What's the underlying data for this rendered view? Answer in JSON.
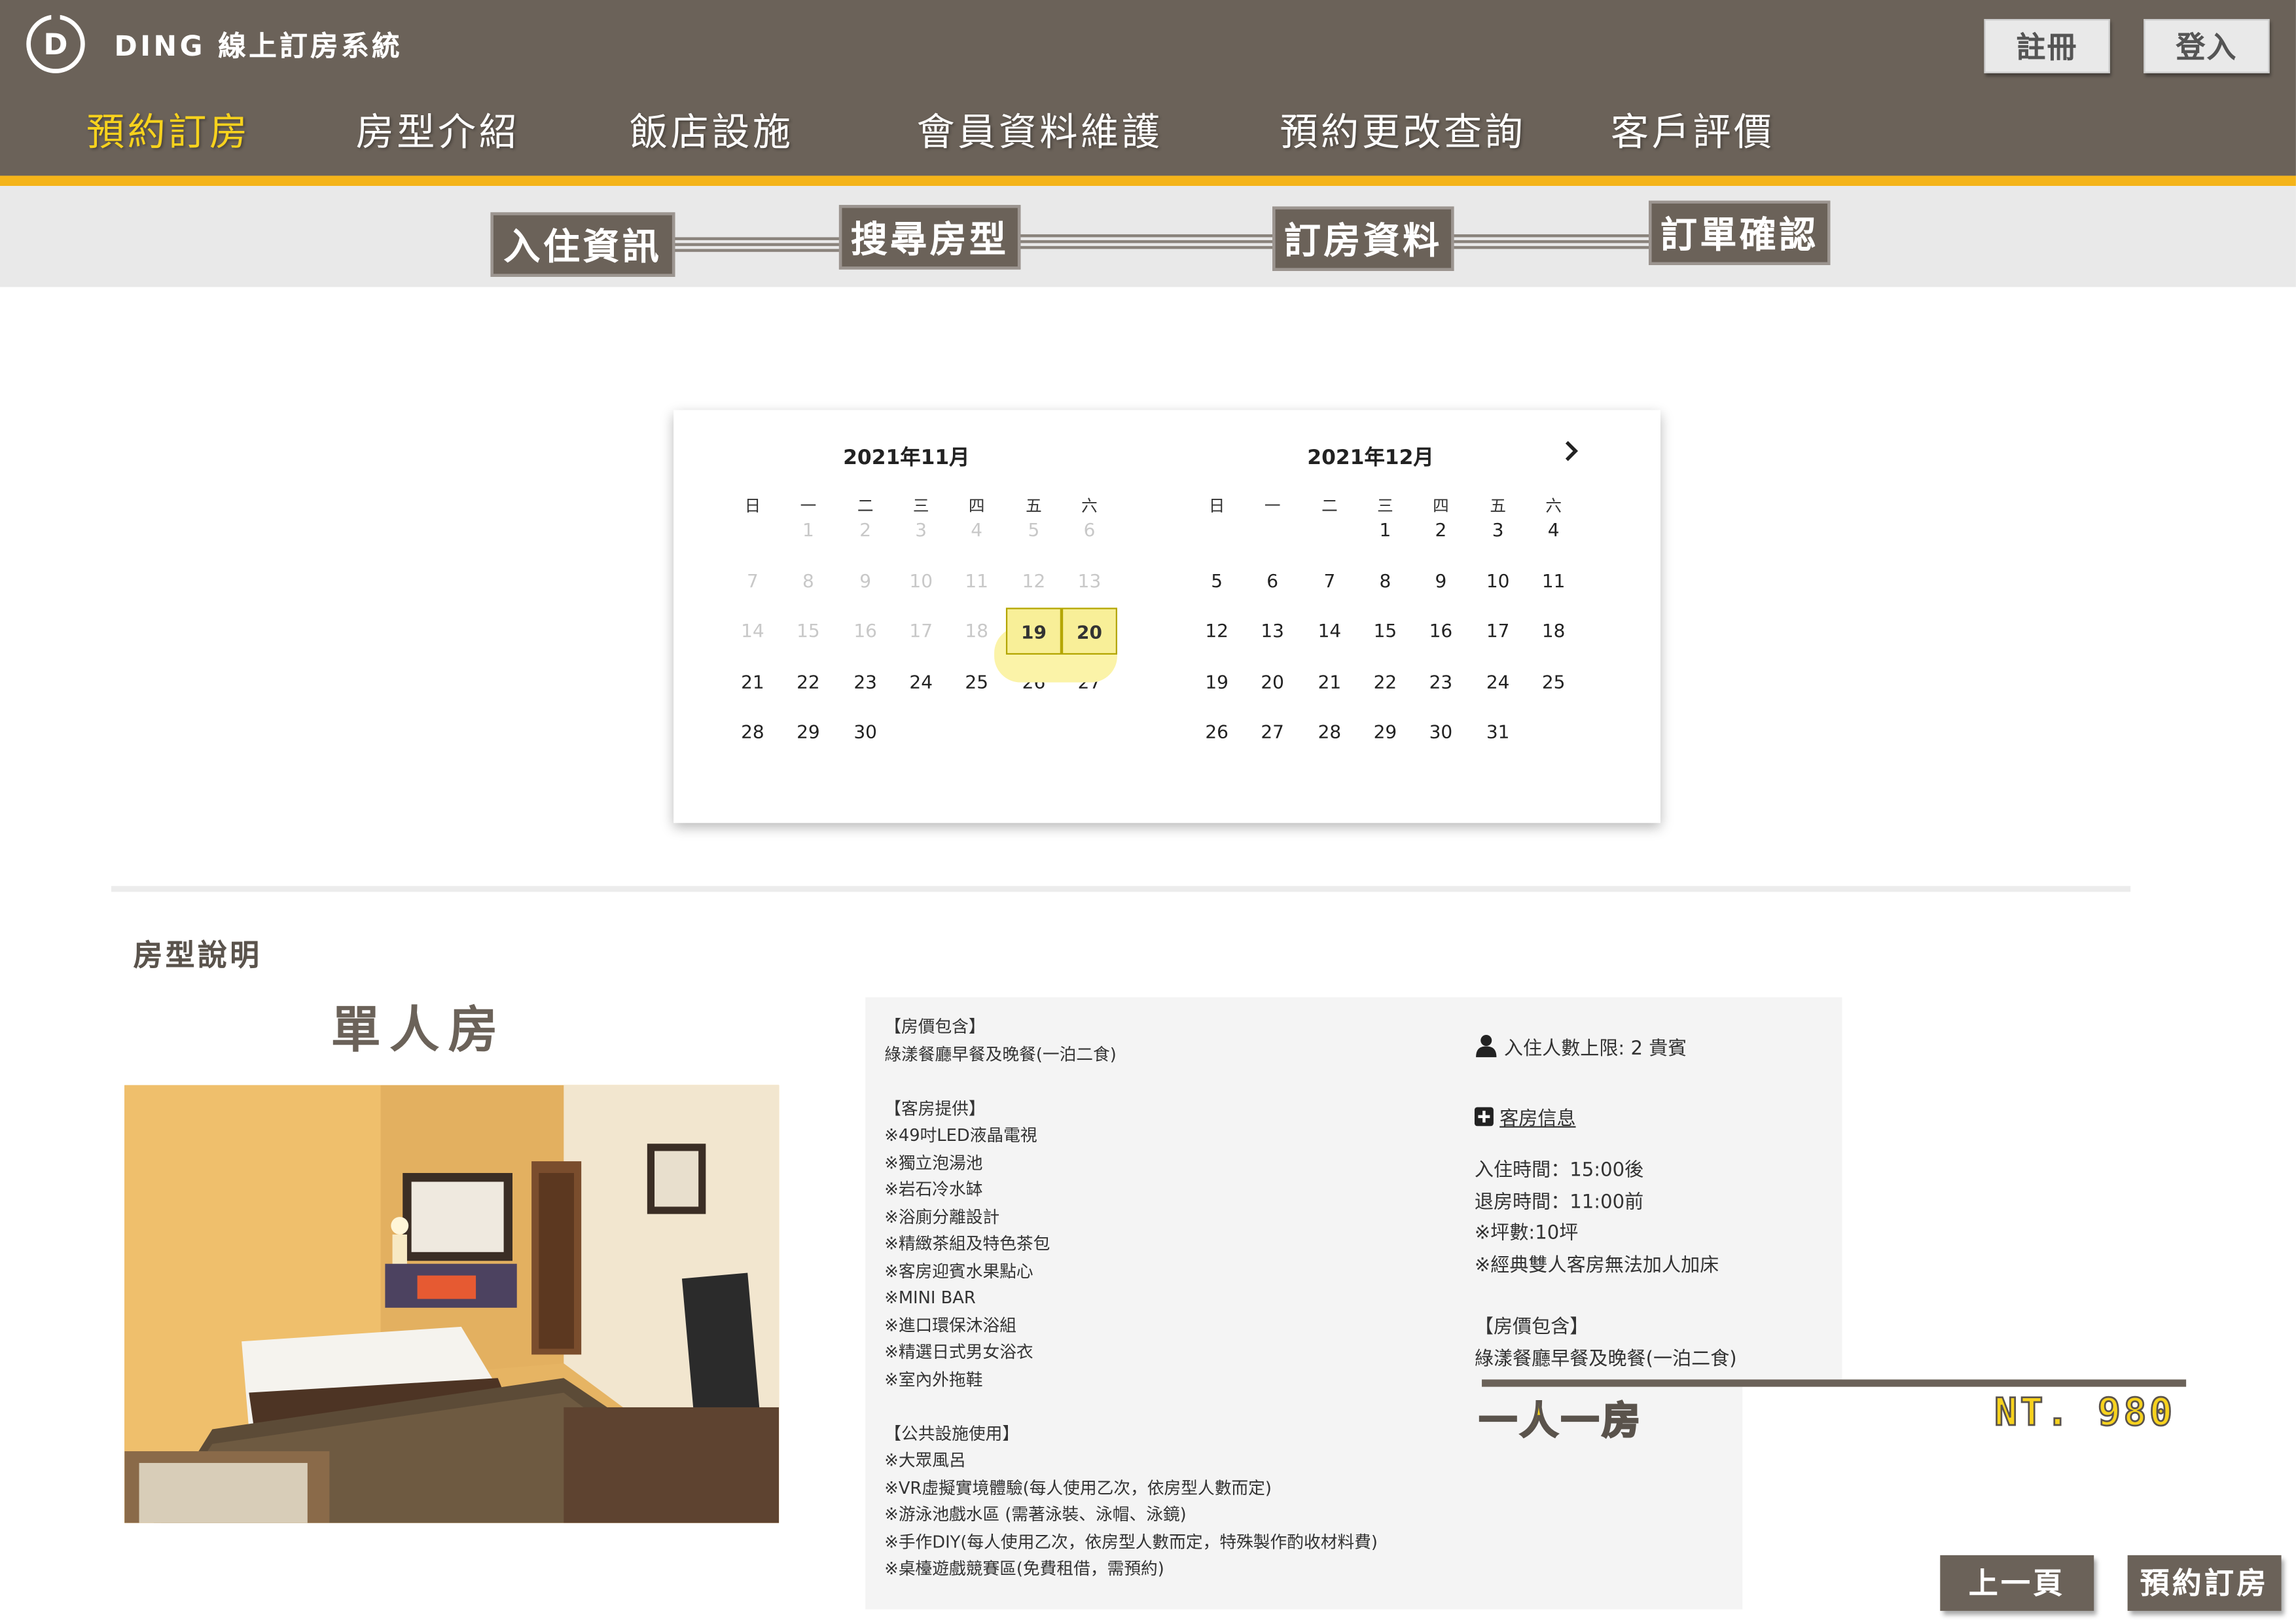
{
  "header": {
    "logo_letter": "D",
    "brand": "DING 線上訂房系統",
    "register": "註冊",
    "login": "登入",
    "nav": [
      "預約訂房",
      "房型介紹",
      "飯店設施",
      "會員資料維護",
      "預約更改查詢",
      "客戶評價"
    ],
    "accent_color": "#f4b41a",
    "bar_color": "#6b6259",
    "active_color": "#f7d21d"
  },
  "steps": [
    "入住資訊",
    "搜尋房型",
    "訂房資料",
    "訂單確認"
  ],
  "calendar": {
    "next_icon": "chevron-right-icon",
    "weekdays": [
      "日",
      "一",
      "二",
      "三",
      "四",
      "五",
      "六"
    ],
    "months": [
      {
        "title": "2021年11月",
        "weeks": [
          [
            "",
            "1",
            "2",
            "3",
            "4",
            "5",
            "6"
          ],
          [
            "7",
            "8",
            "9",
            "10",
            "11",
            "12",
            "13"
          ],
          [
            "14",
            "15",
            "16",
            "17",
            "18",
            "19",
            "20"
          ],
          [
            "21",
            "22",
            "23",
            "24",
            "25",
            "26",
            "27"
          ],
          [
            "28",
            "29",
            "30",
            "",
            "",
            "",
            ""
          ]
        ]
      },
      {
        "title": "2021年12月",
        "weeks": [
          [
            "",
            "",
            "",
            "1",
            "2",
            "3",
            "4"
          ],
          [
            "5",
            "6",
            "7",
            "8",
            "9",
            "10",
            "11"
          ],
          [
            "12",
            "13",
            "14",
            "15",
            "16",
            "17",
            "18"
          ],
          [
            "19",
            "20",
            "21",
            "22",
            "23",
            "24",
            "25"
          ],
          [
            "26",
            "27",
            "28",
            "29",
            "30",
            "31",
            ""
          ]
        ]
      }
    ],
    "past_through": "2021-11-18",
    "selected": [
      "2021-11-19",
      "2021-11-20"
    ]
  },
  "room": {
    "section_title": "房型說明",
    "name": "單人房",
    "amenities": [
      "【房價包含】",
      "綠漾餐廳早餐及晚餐(一泊二食)",
      "",
      "【客房提供】",
      "※49吋LED液晶電視",
      "※獨立泡湯池",
      "※岩石冷水缽",
      "※浴廁分離設計",
      "※精緻茶組及特色茶包",
      "※客房迎賓水果點心",
      "※MINI BAR",
      "※進口環保沐浴組",
      "※精選日式男女浴衣",
      "※室內外拖鞋",
      "",
      "【公共設施使用】",
      "※大眾風呂",
      "※VR虛擬實境體驗(每人使用乙次，依房型人數而定)",
      "※游泳池戲水區 (需著泳裝、泳帽、泳鏡)",
      "※手作DIY(每人使用乙次，依房型人數而定，特殊製作酌收材料費)",
      "※桌檯遊戲競賽區(免費租借，需預約)"
    ],
    "capacity_icon": "user-icon",
    "capacity": "入住人數上限: 2 貴賓",
    "info_icon": "plus-square-icon",
    "info_link": "客房信息",
    "checkin": "入住時間：15:00後",
    "checkout": "退房時間：11:00前",
    "size": "※坪數:10坪",
    "note": "※經典雙人客房無法加人加床",
    "include_title": "【房價包含】",
    "include_text": "綠漾餐廳早餐及晚餐(一泊二食)",
    "plan": "一人一房",
    "price": "NT. 980"
  },
  "buttons": {
    "prev": "上一頁",
    "book": "預約訂房"
  }
}
